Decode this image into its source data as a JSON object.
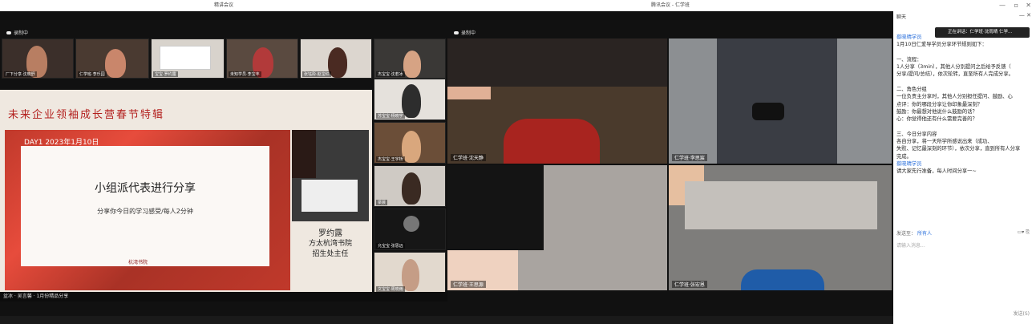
{
  "windows": {
    "left_title": "精讲会议",
    "mid_title": "腾讯会议 - 仁学班",
    "right_title": "聊天"
  },
  "left_meeting": {
    "status": "录制中",
    "thumbnails_top": [
      {
        "name": "厂下分享·沈晓舒"
      },
      {
        "name": "仁学班·李乐园"
      },
      {
        "name": "宝宝·罗约露"
      },
      {
        "name": "未知学员·李宝丰"
      },
      {
        "name": "张钰彤·赵宝红"
      },
      {
        "name": "杰宝宝·沈若冰"
      }
    ],
    "thumbnails_side": [
      {
        "name": "苏宝宝·杨晓宇"
      },
      {
        "name": "杰宝宝·王宇桥"
      },
      {
        "name": "梁晨"
      },
      {
        "name": "允宝宝·张思远"
      },
      {
        "name": "文宝宝·周晓雨"
      }
    ],
    "slide": {
      "title": "未来企业领袖成长营春节特辑",
      "date": "DAY1 2023年1月10日",
      "main": "小组派代表进行分享",
      "sub": "分享你今日的学习感受/每人2分钟",
      "logo": "杭湾书院",
      "teacher_name": "罗约露",
      "teacher_title_1": "方太杭湾书院",
      "teacher_title_2": "招生处主任"
    },
    "bottom_text": "盆冰 · 吴言馨 · 1月份精品分享"
  },
  "mid_meeting": {
    "status": "录制中",
    "tiles": [
      {
        "name": "仁学班·沈天静"
      },
      {
        "name": "仁学班·李思宸"
      },
      {
        "name": "仁学班·王思源"
      },
      {
        "name": "仁学班·张宏恩"
      }
    ]
  },
  "chat": {
    "header": "聊天",
    "toast": "正在讲话：仁学班·沈雨晴 仁学...",
    "sender1": "蔡晓晴学员",
    "messages": [
      "1月10日仁爱导学员分享环节规则如下：",
      "",
      "一、流程：",
      "1人分享（3min），其他人分别提问之后给予反馈（",
      "分享/提问/总结），依次轮转，直至所有人完成分享。",
      "",
      "二、角色分组",
      "一位负责主分享时，其他人分别担任提问、鼓励、心",
      "点评：你的哪段分享让你印象最深刻？",
      "鼓励：你最想对他说什么鼓励的话？",
      "心：你觉得他还有什么需要完善的？",
      "",
      "三、今日分享内容",
      "各自分享，将一天所学所感说出来（成功、",
      "失败、记忆最深刻的环节），依次分享，直到所有人分享",
      "完成。"
    ],
    "sender2": "蔡晓晴学员",
    "last_message": "请大家先行准备，每人时间分享一~",
    "send_to_label": "发送至：",
    "send_to_value": "所有人",
    "input_placeholder": "请输入消息...",
    "send_button": "发送(S)"
  }
}
